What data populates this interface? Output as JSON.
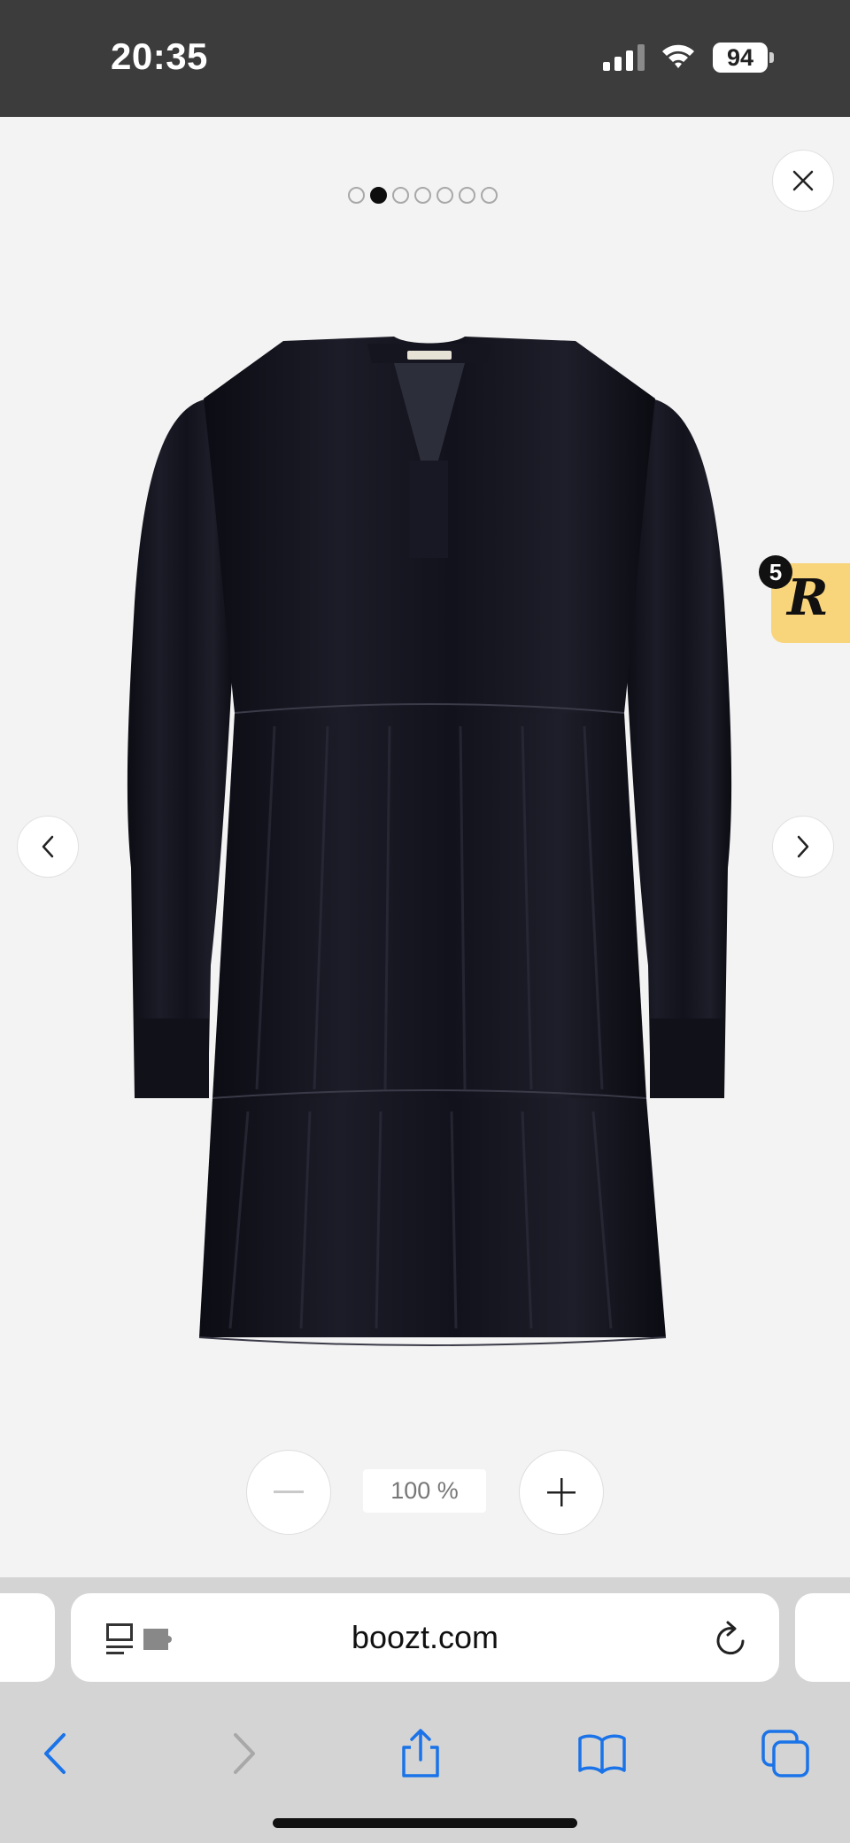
{
  "status_bar": {
    "time": "20:35",
    "battery_level": "94",
    "icons": [
      "cellular-signal-icon",
      "wifi-icon",
      "battery-icon"
    ]
  },
  "gallery": {
    "total_images": 7,
    "current_index": 2,
    "image_description_icon": "dress-product-image",
    "brand_label": "Part Two"
  },
  "badge": {
    "count": "5",
    "letter": "R",
    "color": "#f8d47b"
  },
  "zoom": {
    "level": "100 %"
  },
  "browser": {
    "url": "boozt.com",
    "accent_color": "#1a73e8"
  }
}
